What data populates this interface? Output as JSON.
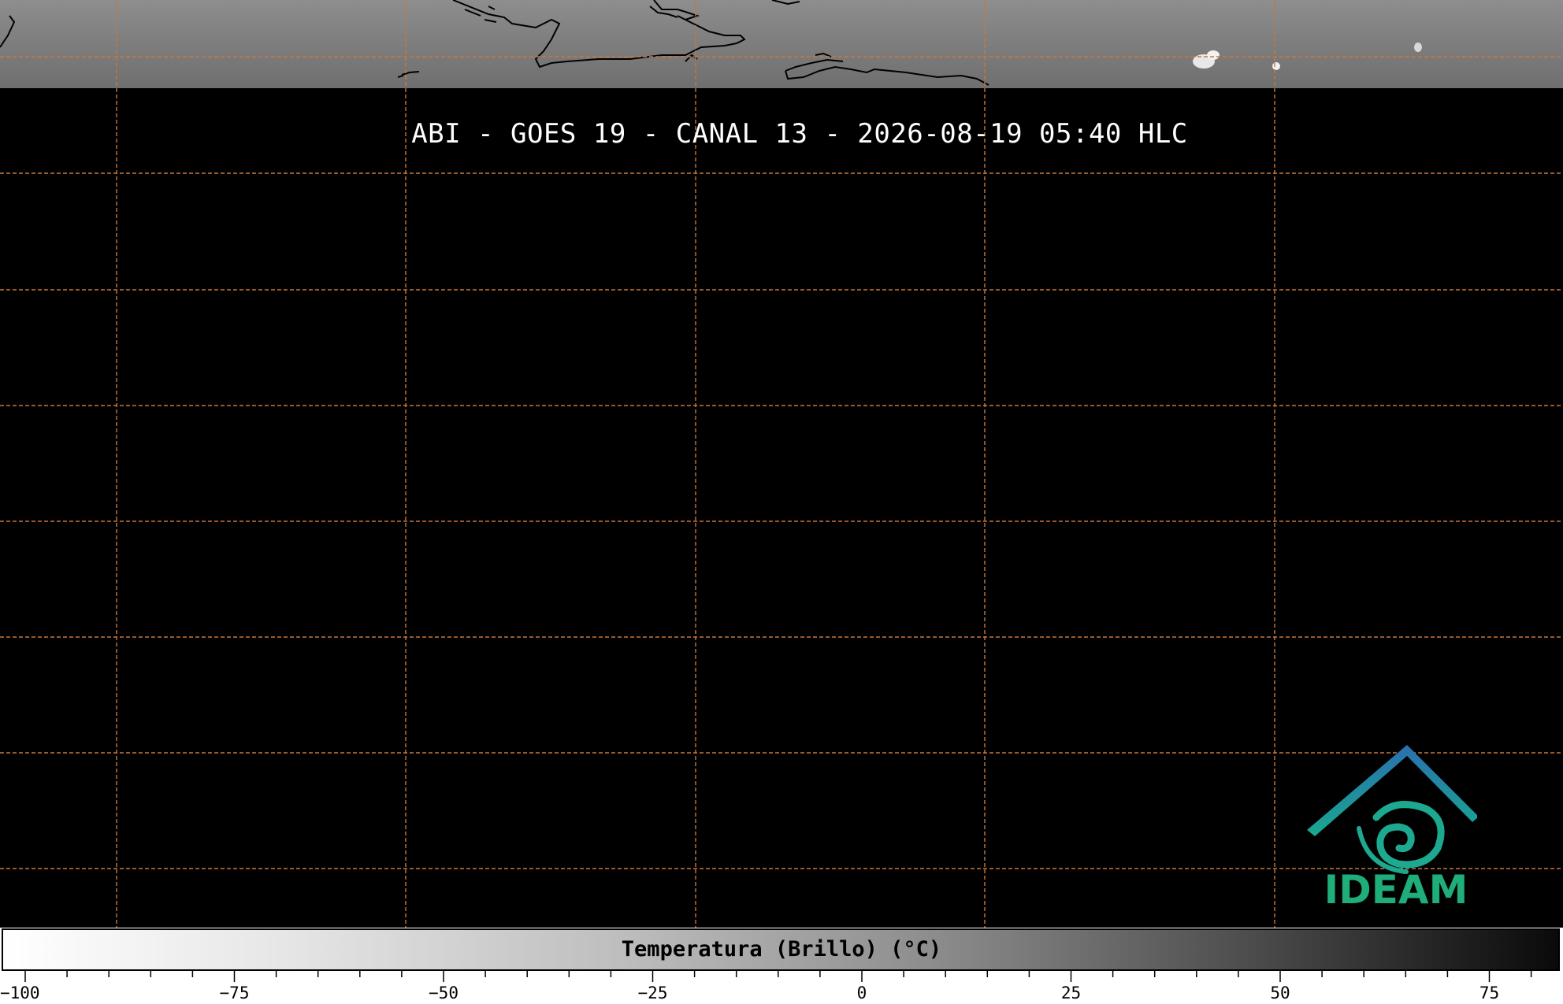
{
  "title": "ABI - GOES 19 - CANAL 13 - 2026-08-19 05:40 HLC",
  "logo": {
    "text": "IDEAM",
    "colors": {
      "text": "#1fae7a",
      "arc_top": "#2a6fb0",
      "arc_bottom": "#19a88f"
    }
  },
  "colorbar": {
    "label": "Temperatura (Brillo) (°C)",
    "min": -100,
    "max": 85,
    "major_ticks": [
      "-100",
      "-75",
      "-50",
      "-25",
      "0",
      "25",
      "50",
      "75"
    ],
    "colormap": "white-to-black"
  },
  "map": {
    "gridline_color": "#c8783c",
    "background": "#000000",
    "coastline_color": "#000000"
  }
}
